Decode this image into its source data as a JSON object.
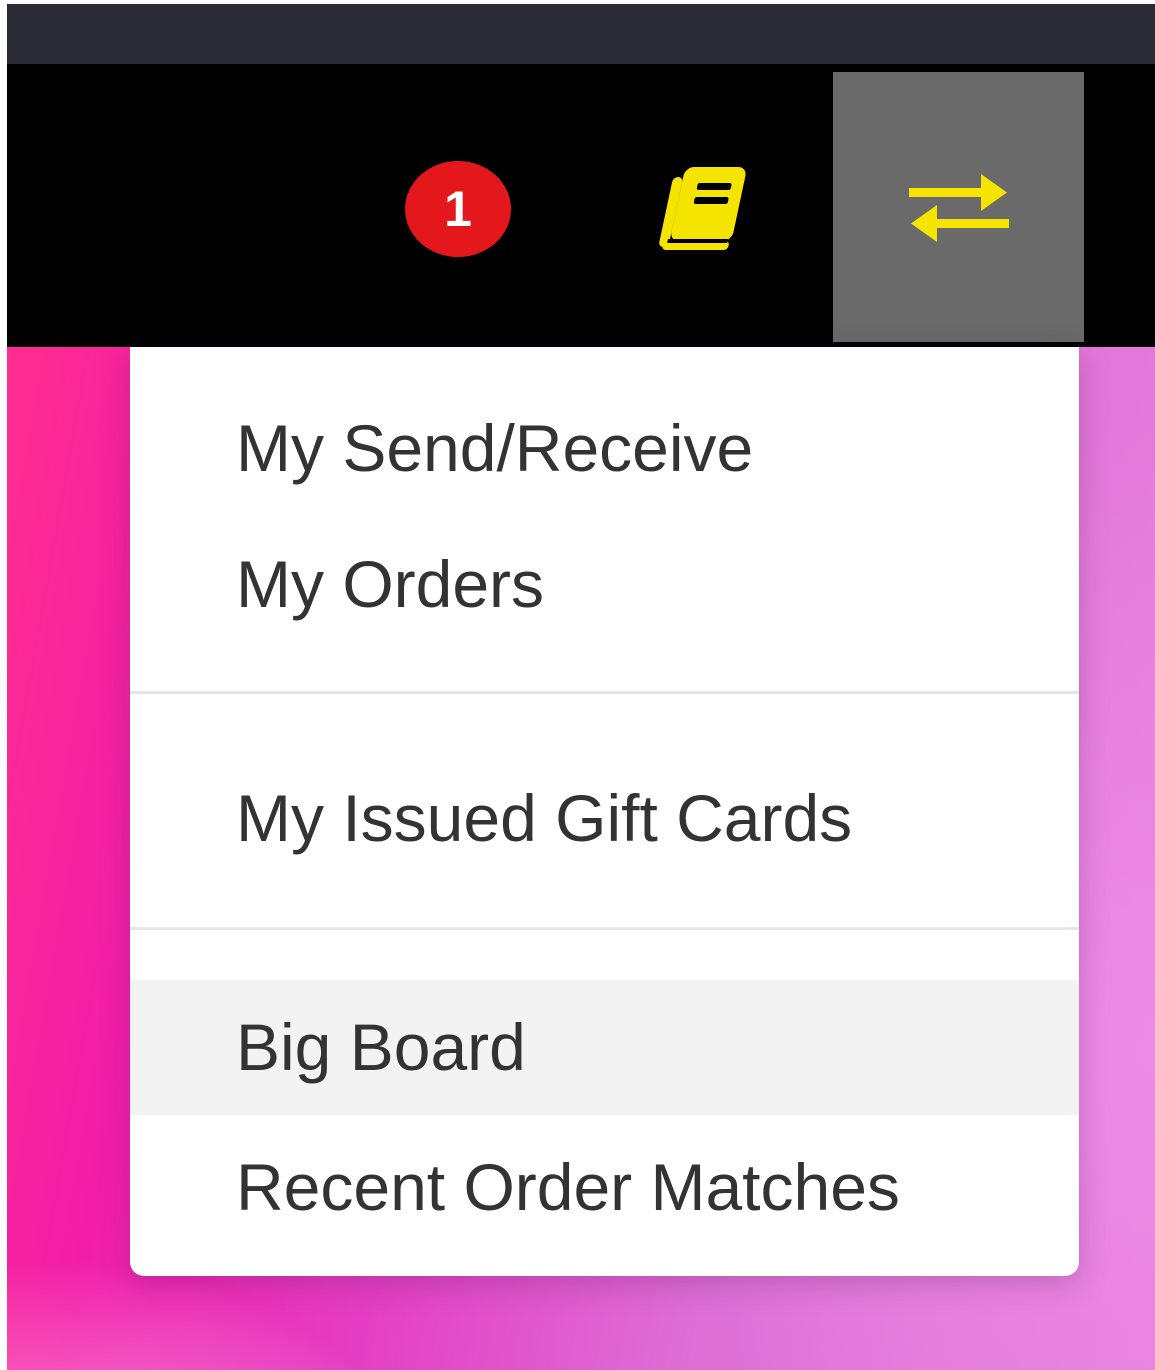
{
  "navbar": {
    "notification_count": "1",
    "book_icon": "book-icon",
    "swap_icon": "exchange-arrows-icon",
    "icon_color": "#f5e400",
    "badge_color": "#e3171c",
    "active_button_bg": "#6a6a6a"
  },
  "menu": {
    "items": [
      {
        "label": "My Send/Receive"
      },
      {
        "label": "My Orders"
      },
      {
        "label": "My Issued Gift Cards"
      },
      {
        "label": "Big Board",
        "highlighted": true
      },
      {
        "label": "Recent Order Matches"
      }
    ]
  }
}
